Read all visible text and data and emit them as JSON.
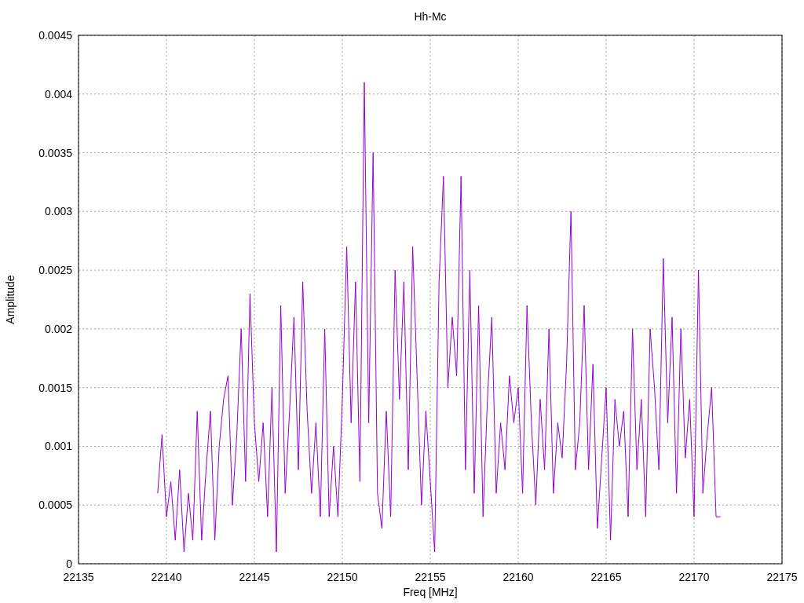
{
  "chart_data": {
    "type": "line",
    "title": "Hh-Mc",
    "xlabel": "Freq [MHz]",
    "ylabel": "Amplitude",
    "grid": true,
    "xlim": [
      22135,
      22175
    ],
    "ylim": [
      0,
      0.0045
    ],
    "xticks": [
      22135,
      22140,
      22145,
      22150,
      22155,
      22160,
      22165,
      22170,
      22175
    ],
    "yticks": [
      0,
      0.0005,
      0.001,
      0.0015,
      0.002,
      0.0025,
      0.003,
      0.0035,
      0.004,
      0.0045
    ],
    "x": [
      22139.5,
      22139.75,
      22140,
      22140.25,
      22140.5,
      22140.75,
      22141,
      22141.25,
      22141.5,
      22141.75,
      22142,
      22142.25,
      22142.5,
      22142.75,
      22143,
      22143.25,
      22143.5,
      22143.75,
      22144,
      22144.25,
      22144.5,
      22144.75,
      22145,
      22145.25,
      22145.5,
      22145.75,
      22146,
      22146.25,
      22146.5,
      22146.75,
      22147,
      22147.25,
      22147.5,
      22147.75,
      22148,
      22148.25,
      22148.5,
      22148.75,
      22149,
      22149.25,
      22149.5,
      22149.75,
      22150,
      22150.25,
      22150.5,
      22150.75,
      22151,
      22151.25,
      22151.5,
      22151.75,
      22152,
      22152.25,
      22152.5,
      22152.75,
      22153,
      22153.25,
      22153.5,
      22153.75,
      22154,
      22154.25,
      22154.5,
      22154.75,
      22155,
      22155.25,
      22155.5,
      22155.75,
      22156,
      22156.25,
      22156.5,
      22156.75,
      22157,
      22157.25,
      22157.5,
      22157.75,
      22158,
      22158.25,
      22158.5,
      22158.75,
      22159,
      22159.25,
      22159.5,
      22159.75,
      22160,
      22160.25,
      22160.5,
      22160.75,
      22161,
      22161.25,
      22161.5,
      22161.75,
      22162,
      22162.25,
      22162.5,
      22162.75,
      22163,
      22163.25,
      22163.5,
      22163.75,
      22164,
      22164.25,
      22164.5,
      22164.75,
      22165,
      22165.25,
      22165.5,
      22165.75,
      22166,
      22166.25,
      22166.5,
      22166.75,
      22167,
      22167.25,
      22167.5,
      22167.75,
      22168,
      22168.25,
      22168.5,
      22168.75,
      22169,
      22169.25,
      22169.5,
      22169.75,
      22170,
      22170.25,
      22170.5,
      22170.75,
      22171,
      22171.25,
      22171.5
    ],
    "series": [
      {
        "color": "#9400d3",
        "values": [
          0.0006,
          0.0011,
          0.0004,
          0.0007,
          0.0002,
          0.0008,
          0.0001,
          0.0006,
          0.0002,
          0.0013,
          0.0002,
          0.0008,
          0.0013,
          0.0002,
          0.001,
          0.0014,
          0.0016,
          0.0005,
          0.0011,
          0.002,
          0.0007,
          0.0023,
          0.0012,
          0.0007,
          0.0012,
          0.0004,
          0.0015,
          0.0001,
          0.0022,
          0.0006,
          0.0013,
          0.0021,
          0.0008,
          0.0024,
          0.0013,
          0.0006,
          0.0012,
          0.0004,
          0.002,
          0.0004,
          0.001,
          0.0004,
          0.0014,
          0.0027,
          0.0012,
          0.0024,
          0.0007,
          0.0041,
          0.0012,
          0.0035,
          0.0006,
          0.0003,
          0.0013,
          0.0004,
          0.0025,
          0.0014,
          0.0024,
          0.0008,
          0.0027,
          0.0016,
          0.0005,
          0.0013,
          0.0007,
          0.0001,
          0.0024,
          0.0033,
          0.0015,
          0.0021,
          0.0016,
          0.0033,
          0.0008,
          0.0025,
          0.0006,
          0.0022,
          0.0004,
          0.0014,
          0.0021,
          0.0006,
          0.0012,
          0.0008,
          0.0016,
          0.0012,
          0.0015,
          0.0006,
          0.0022,
          0.0012,
          0.0005,
          0.0014,
          0.0008,
          0.002,
          0.0006,
          0.0012,
          0.0009,
          0.0017,
          0.003,
          0.0008,
          0.0012,
          0.0022,
          0.0008,
          0.0017,
          0.0003,
          0.0009,
          0.0015,
          0.0002,
          0.0014,
          0.001,
          0.0013,
          0.0004,
          0.002,
          0.0008,
          0.0014,
          0.0004,
          0.002,
          0.0015,
          0.0008,
          0.0026,
          0.0012,
          0.0021,
          0.0006,
          0.002,
          0.0009,
          0.0014,
          0.0004,
          0.0025,
          0.0006,
          0.0011,
          0.0015,
          0.0004,
          0.0004
        ]
      }
    ]
  }
}
